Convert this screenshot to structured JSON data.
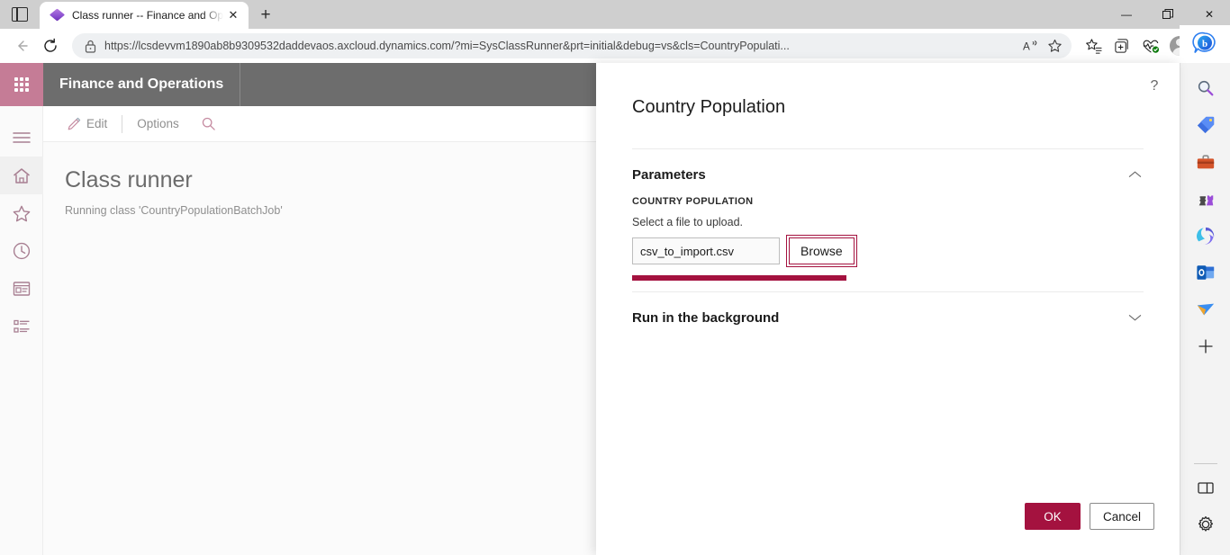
{
  "browser": {
    "tab": {
      "title": "Class runner -- Finance and Oper",
      "favicon": "dynamics-diamond-icon",
      "close_label": "✕"
    },
    "new_tab_label": "+",
    "tab_search_icon": "tab-search-icon",
    "window_controls": {
      "minimize": "—",
      "restore": "❐",
      "close": "✕"
    },
    "nav": {
      "back": "←",
      "forward": "→",
      "reload": "⟳"
    },
    "omnibox": {
      "lock_icon": "lock-icon",
      "url": "https://lcsdevvm1890ab8b9309532daddevaos.axcloud.dynamics.com/?mi=SysClassRunner&prt=initial&debug=vs&cls=CountryPopulati...",
      "read_aloud_icon": "read-aloud-icon",
      "favorite_icon": "star-outline-icon"
    },
    "toolbar_icons": [
      {
        "name": "favorites-icon",
        "glyph": "☆"
      },
      {
        "name": "collections-icon",
        "glyph": "⧉"
      },
      {
        "name": "browser-essentials-icon",
        "glyph": "♡"
      },
      {
        "name": "profile-avatar",
        "glyph": ""
      },
      {
        "name": "settings-and-more-icon",
        "glyph": "⋯"
      }
    ],
    "sidebar": {
      "copilot_label": "Copilot",
      "items": [
        {
          "name": "search-icon",
          "label": "Search"
        },
        {
          "name": "shopping-tag-icon",
          "label": "Shopping"
        },
        {
          "name": "tools-icon",
          "label": "Tools"
        },
        {
          "name": "games-icon",
          "label": "Games"
        },
        {
          "name": "microsoft-365-icon",
          "label": "Microsoft 365"
        },
        {
          "name": "outlook-icon",
          "label": "Outlook"
        },
        {
          "name": "drop-icon",
          "label": "Drop"
        },
        {
          "name": "add-sidebar-app-icon",
          "label": "+"
        }
      ],
      "bottom_items": [
        {
          "name": "split-screen-icon",
          "label": "Split screen"
        },
        {
          "name": "sidebar-settings-icon",
          "label": "Customize"
        }
      ]
    }
  },
  "app": {
    "header": {
      "waffle_icon": "app-launcher-icon",
      "title": "Finance and Operations"
    },
    "nav_rail": [
      {
        "name": "sidebar-item-menu",
        "icon": "hamburger-icon",
        "label": "Expand the navigation pane"
      },
      {
        "name": "sidebar-item-home",
        "icon": "home-icon",
        "label": "Home"
      },
      {
        "name": "sidebar-item-favorites",
        "icon": "star-icon",
        "label": "Favorites"
      },
      {
        "name": "sidebar-item-recent",
        "icon": "clock-icon",
        "label": "Recent"
      },
      {
        "name": "sidebar-item-workspaces",
        "icon": "workspace-icon",
        "label": "Workspaces"
      },
      {
        "name": "sidebar-item-modules",
        "icon": "list-icon",
        "label": "Modules"
      }
    ],
    "command_bar": {
      "edit_label": "Edit",
      "edit_icon": "pencil-icon",
      "options_label": "Options",
      "search_icon": "search-icon"
    },
    "page": {
      "title": "Class runner",
      "subtitle": "Running class 'CountryPopulationBatchJob'"
    }
  },
  "dialog": {
    "title": "Country Population",
    "help_icon": "help-icon",
    "sections": [
      {
        "name": "parameters",
        "title": "Parameters",
        "expanded": true,
        "chevron": "chevron-up-icon"
      },
      {
        "name": "run-in-the-background",
        "title": "Run in the background",
        "expanded": false,
        "chevron": "chevron-down-icon"
      }
    ],
    "field": {
      "group_label": "COUNTRY POPULATION",
      "description": "Select a file to upload.",
      "file_value": "csv_to_import.csv",
      "file_placeholder": "",
      "browse_label": "Browse",
      "progress_percent": 100
    },
    "footer": {
      "ok_label": "OK",
      "cancel_label": "Cancel"
    }
  },
  "colors": {
    "accent_crimson": "#a4123f",
    "waffle_pink": "#c57c96",
    "header_gray": "#6d6d6d",
    "nav_icon": "#a87f92"
  }
}
